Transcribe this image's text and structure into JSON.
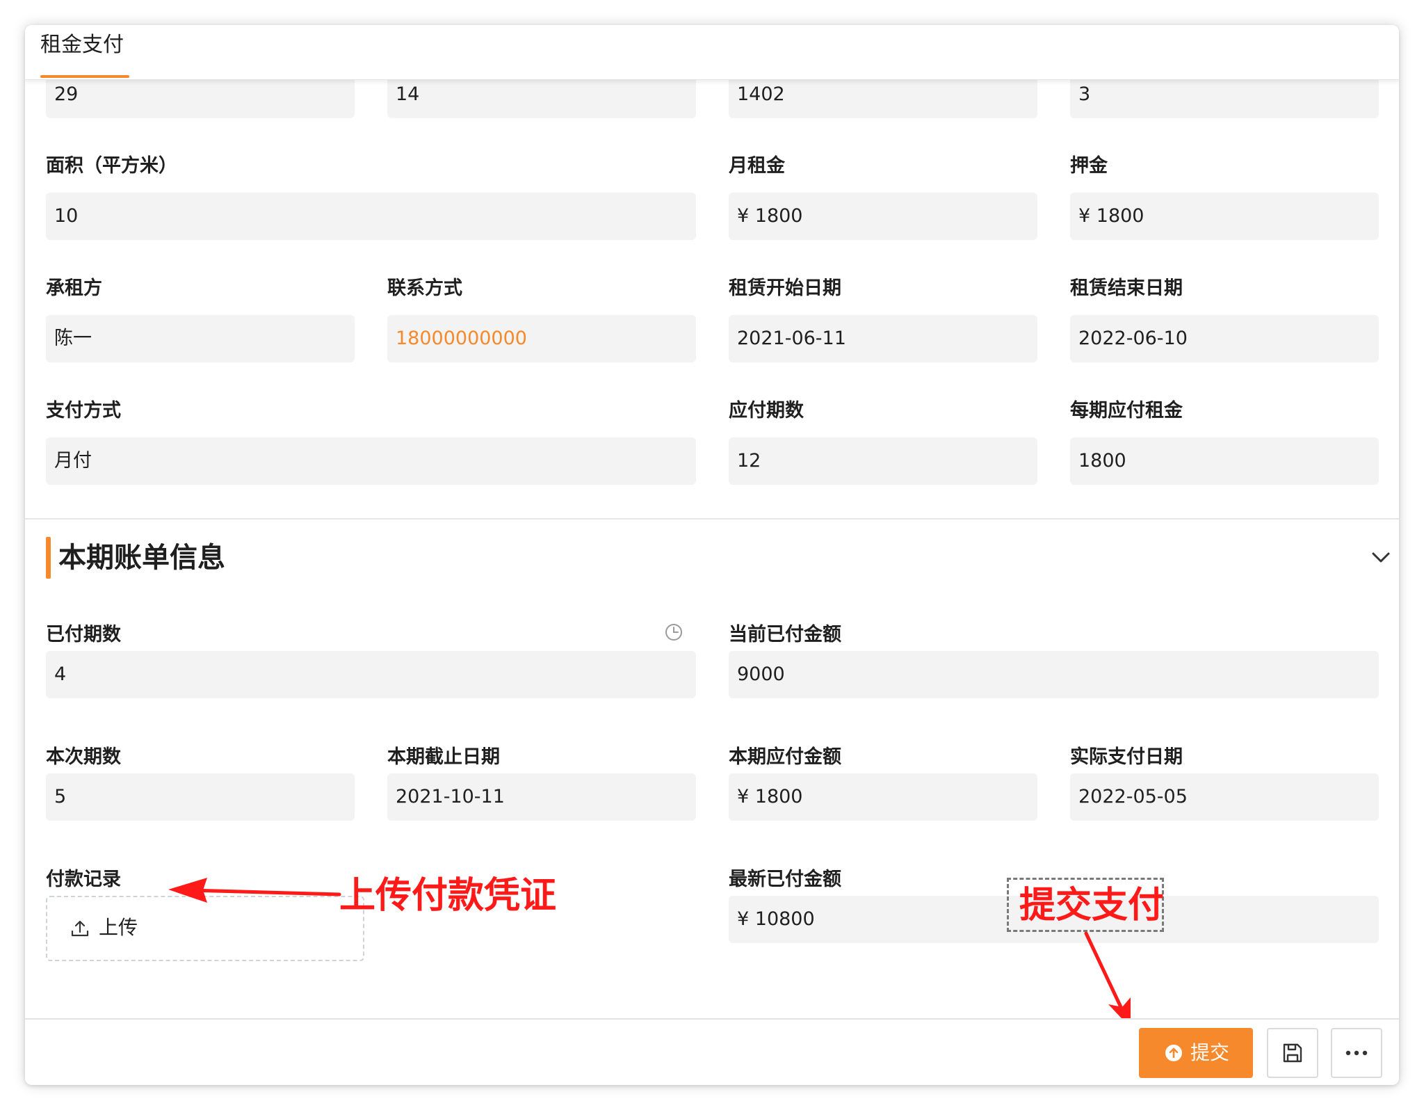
{
  "tab": {
    "title": "租金支付"
  },
  "top_row": {
    "values": [
      "29",
      "14",
      "1402",
      "3"
    ]
  },
  "lease": {
    "area": {
      "label": "面积（平方米）",
      "value": "10"
    },
    "monthly_rent": {
      "label": "月租金",
      "value": "¥ 1800"
    },
    "deposit": {
      "label": "押金",
      "value": "¥ 1800"
    },
    "tenant": {
      "label": "承租方",
      "value": "陈一"
    },
    "contact": {
      "label": "联系方式",
      "value": "18000000000"
    },
    "start_date": {
      "label": "租赁开始日期",
      "value": "2021-06-11"
    },
    "end_date": {
      "label": "租赁结束日期",
      "value": "2022-06-10"
    },
    "payment_method": {
      "label": "支付方式",
      "value": "月付"
    },
    "periods_due": {
      "label": "应付期数",
      "value": "12"
    },
    "rent_per_period": {
      "label": "每期应付租金",
      "value": "1800"
    }
  },
  "bill": {
    "section_title": "本期账单信息",
    "paid_periods": {
      "label": "已付期数",
      "value": "4"
    },
    "paid_amount": {
      "label": "当前已付金额",
      "value": "9000"
    },
    "current_period": {
      "label": "本次期数",
      "value": "5"
    },
    "due_date": {
      "label": "本期截止日期",
      "value": "2021-10-11"
    },
    "amount_due": {
      "label": "本期应付金额",
      "value": "¥ 1800"
    },
    "actual_pay_date": {
      "label": "实际支付日期",
      "value": "2022-05-05"
    },
    "payment_record": {
      "label": "付款记录",
      "upload_label": "上传"
    },
    "latest_paid": {
      "label": "最新已付金额",
      "value": "¥ 10800"
    }
  },
  "annotations": {
    "upload_hint": "上传付款凭证",
    "submit_hint": "提交支付"
  },
  "footer": {
    "submit_label": "提交"
  },
  "colors": {
    "accent": "#f5892c",
    "annotation": "#ff1a1a",
    "field_bg": "#f2f3f2"
  }
}
